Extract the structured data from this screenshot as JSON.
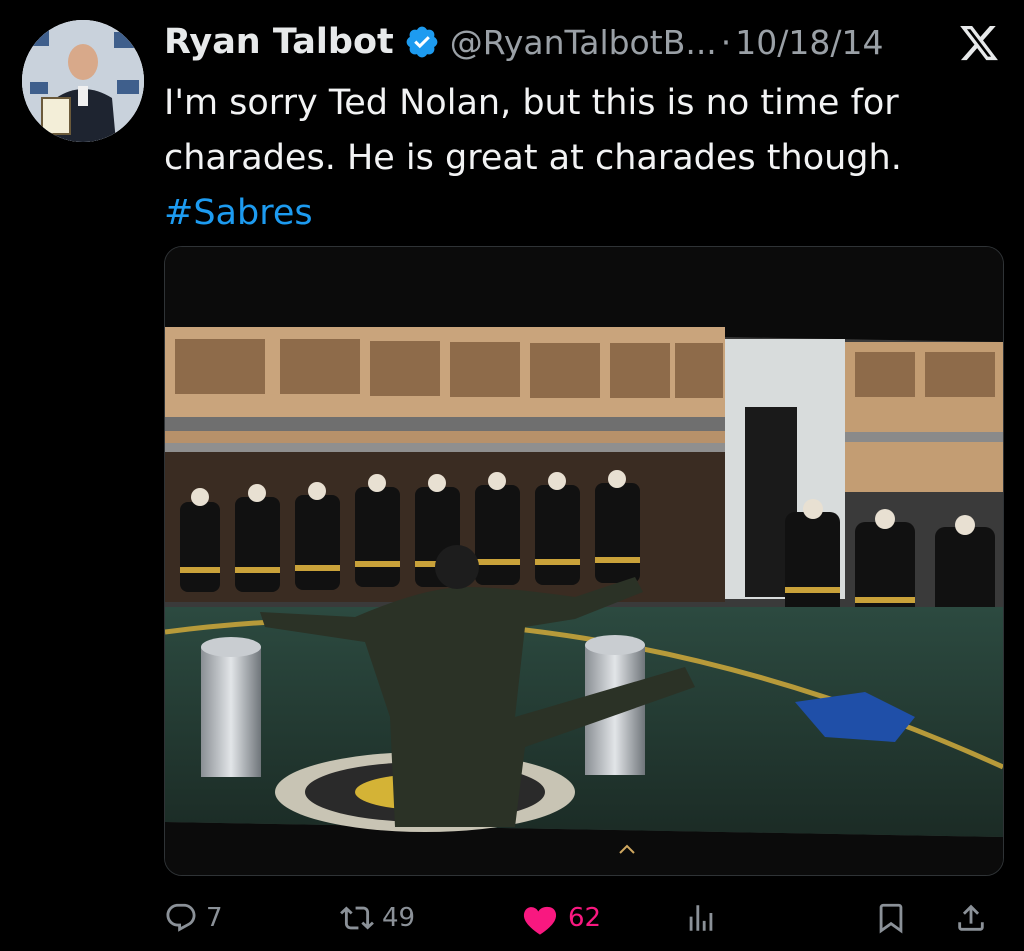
{
  "tweet": {
    "author_name": "Ryan Talbot",
    "handle": "@RyanTalbotB...",
    "separator": "·",
    "date": "10/18/14",
    "text_lines": [
      "I'm sorry Ted Nolan, but this is no time for",
      "charades. He is great at charades though."
    ],
    "hashtag": "#Sabres"
  },
  "icons": {
    "verified": "verified-badge-icon",
    "platform": "x-logo-icon",
    "reply": "reply-icon",
    "retweet": "retweet-icon",
    "like": "heart-icon",
    "views": "views-icon",
    "bookmark": "bookmark-icon",
    "share": "share-icon"
  },
  "actions": {
    "reply_count": "7",
    "retweet_count": "49",
    "like_count": "62"
  },
  "colors": {
    "background": "#000000",
    "accent": "#1d9bf0",
    "like": "#f91880",
    "muted": "#9aa0a6"
  }
}
